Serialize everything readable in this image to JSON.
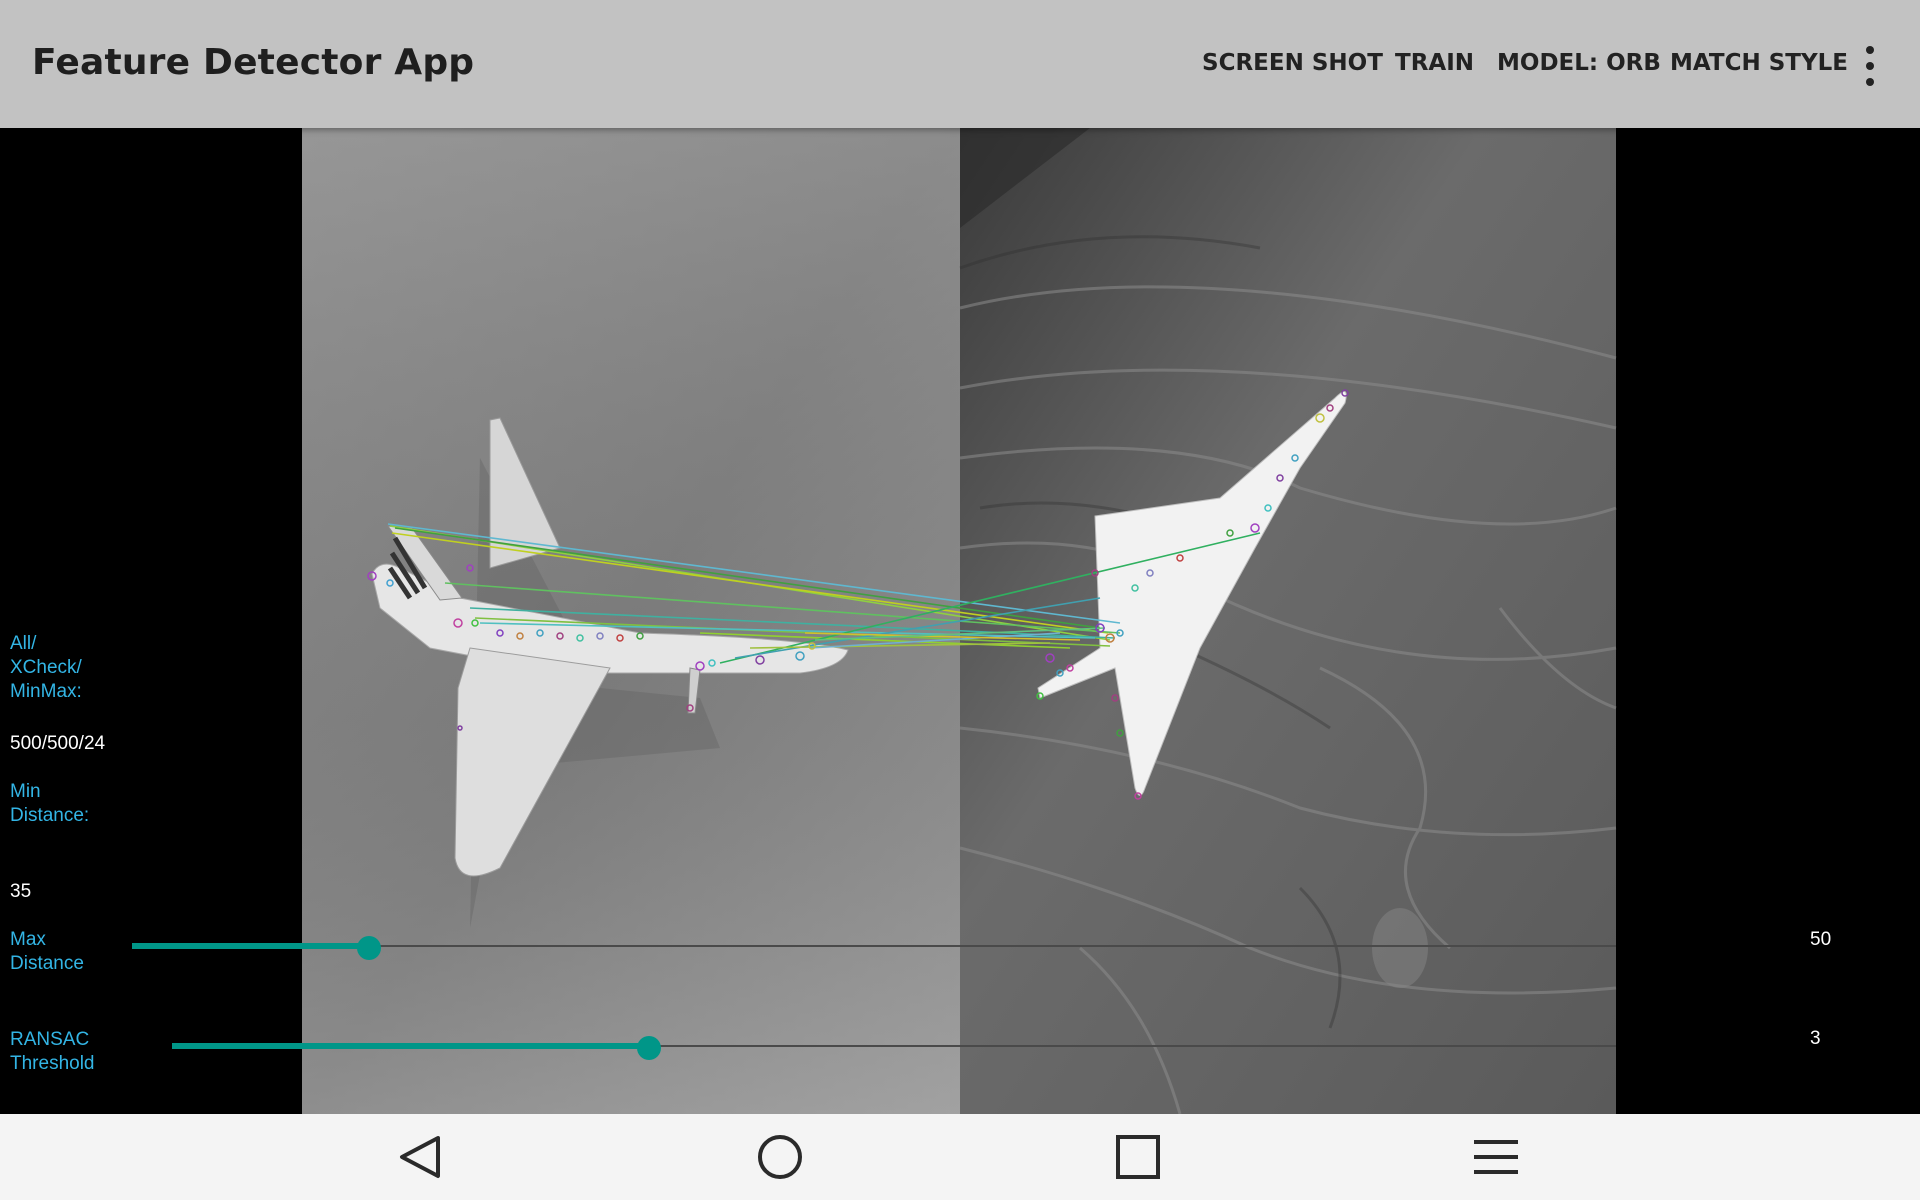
{
  "app": {
    "title": "Feature Detector App"
  },
  "toolbar": {
    "screenshot_label": "SCREEN SHOT",
    "train_label": "TRAIN",
    "model_label": "MODEL: ORB",
    "match_style_label": "MATCH STYLE",
    "overflow_icon": "more-vert-icon"
  },
  "stats": {
    "all_xcheck_minmax_label": "All/\nXCheck/\nMinMax:",
    "all_xcheck_minmax_value": "500/500/24",
    "min_distance_label": "Min\nDistance:",
    "min_distance_value": "35",
    "max_distance_label": "Max\nDistance",
    "max_distance_value": "50",
    "ransac_label": "RANSAC\nThreshold",
    "ransac_value": "3"
  },
  "sliders": {
    "max_distance_level": 0.16,
    "ransac_level": 0.33
  },
  "colors": {
    "accent": "#009688",
    "label": "#33b5e5",
    "appbar": "#c2c2c2"
  },
  "navbar": {
    "back_icon": "back-triangle-icon",
    "home_icon": "home-circle-icon",
    "recents_icon": "recents-square-icon",
    "menu_icon": "menu-lines-icon"
  }
}
